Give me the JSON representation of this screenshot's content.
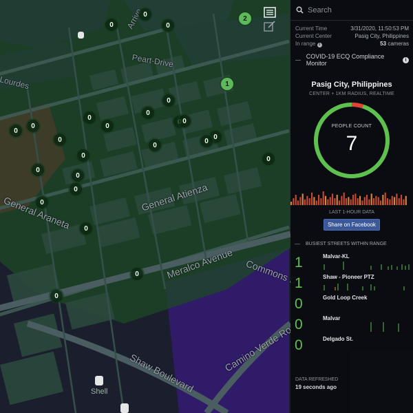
{
  "map": {
    "roads": {
      "peart_drive": "Peart-Drive",
      "arrive": "Arrive",
      "lourdes": "Lourdes",
      "general_araneta": "General Araneta",
      "general_atienza": "General Atienza",
      "meralco_avenue": "Meralco Avenue",
      "commons_drive": "Commons D",
      "shaw_boulevard": "Shaw Boulevard",
      "camino_verde": "Camino Verde Ro"
    },
    "markers": [
      {
        "label": "0",
        "color": "dark"
      },
      {
        "label": "0",
        "color": "dark"
      },
      {
        "label": "2",
        "color": "green"
      },
      {
        "label": "1",
        "color": "green"
      },
      {
        "label": "0",
        "color": "dark"
      },
      {
        "label": "0",
        "color": "dark"
      },
      {
        "label": "0",
        "color": "dark"
      },
      {
        "label": "0",
        "color": "dark"
      },
      {
        "label": "0",
        "color": "dark"
      },
      {
        "label": "0",
        "color": "dark"
      },
      {
        "label": "0",
        "color": "dark"
      },
      {
        "label": "0",
        "color": "dark"
      },
      {
        "label": "0",
        "color": "dark"
      },
      {
        "label": "0",
        "color": "dark"
      },
      {
        "label": "0",
        "color": "dark"
      },
      {
        "label": "0",
        "color": "dark"
      },
      {
        "label": "0",
        "color": "dark"
      },
      {
        "label": "0",
        "color": "dark"
      },
      {
        "label": "0",
        "color": "dark"
      },
      {
        "label": "0",
        "color": "dark"
      },
      {
        "label": "0",
        "color": "dark"
      },
      {
        "label": "0",
        "color": "dark"
      },
      {
        "label": "0",
        "color": "dark"
      },
      {
        "label": "0",
        "color": "dark"
      },
      {
        "label": "0",
        "color": "dark"
      },
      {
        "label": "0",
        "color": "dark"
      }
    ],
    "poi_shell": "Shell"
  },
  "panel": {
    "search_placeholder": "Search",
    "current_time_label": "Current Time",
    "current_time_value": "3/31/2020, 11:50:53 PM",
    "current_center_label": "Current Center",
    "current_center_value": "Pasig City, Philippines",
    "in_range_label": "In range",
    "in_range_count": "53",
    "in_range_unit": "cameras",
    "monitor_title": "COVID-19 ECQ Compliance Monitor",
    "location": "Pasig City, Philippines",
    "sublocation": "CENTER + 1KM RADIUS, REALTIME",
    "people_count_label": "PEOPLE COUNT",
    "people_count": "7",
    "gauge_fraction": 0.95,
    "colors": {
      "gauge_ok": "#5ec04d",
      "gauge_alert": "#e04437",
      "bars": "#c74a2e",
      "facebook": "#3b5998",
      "counts": "#5ec04d"
    },
    "last_hour_label": "LAST 1-HOUR DATA",
    "share_button": "Share on Facebook",
    "busiest_title": "BUSIEST STREETS WITHIN RANGE",
    "streets": [
      {
        "count": "1",
        "name": "Malvar-KL"
      },
      {
        "count": "1",
        "name": "Shaw - Pioneer PTZ"
      },
      {
        "count": "0",
        "name": "Gold Loop Creek"
      },
      {
        "count": "0",
        "name": "Malvar"
      },
      {
        "count": "0",
        "name": "Delgado St."
      }
    ],
    "refreshed_label": "DATA REFRESHED",
    "refreshed_value": "19 seconds ago",
    "hour_bars": [
      3,
      6,
      9,
      4,
      7,
      10,
      5,
      8,
      6,
      11,
      7,
      4,
      9,
      6,
      12,
      8,
      5,
      7,
      10,
      6,
      9,
      4,
      8,
      11,
      6,
      7,
      5,
      9,
      10,
      6,
      8,
      4,
      7,
      9,
      5,
      10,
      6,
      8,
      7,
      4,
      9,
      11,
      6,
      5,
      8,
      7,
      10,
      6,
      9,
      5,
      8
    ]
  }
}
